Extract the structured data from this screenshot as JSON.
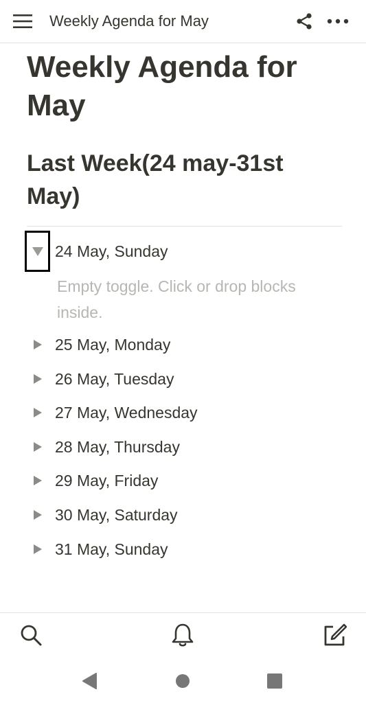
{
  "topbar": {
    "title": "Weekly Agenda for May",
    "menu_icon": "hamburger-menu-icon",
    "share_icon": "share-icon",
    "more_icon": "more-horizontal-icon"
  },
  "page": {
    "title": "Weekly Agenda for May",
    "heading": "Last Week(24 may-31st May)",
    "empty_toggle_hint": "Empty toggle. Click or drop blocks inside.",
    "toggles": [
      {
        "label": "24 May, Sunday",
        "expanded": true
      },
      {
        "label": "25 May, Monday",
        "expanded": false
      },
      {
        "label": "26 May, Tuesday",
        "expanded": false
      },
      {
        "label": "27 May, Wednesday",
        "expanded": false
      },
      {
        "label": "28 May, Thursday",
        "expanded": false
      },
      {
        "label": "29 May, Friday",
        "expanded": false
      },
      {
        "label": "30 May, Saturday",
        "expanded": false
      },
      {
        "label": "31 May, Sunday",
        "expanded": false
      }
    ]
  },
  "bottombar": {
    "search_icon": "search-icon",
    "notifications_icon": "bell-icon",
    "new_page_icon": "compose-icon"
  },
  "navbar": {
    "back_icon": "back-triangle-icon",
    "home_icon": "home-circle-icon",
    "recents_icon": "recents-square-icon"
  },
  "colors": {
    "text": "#37352f",
    "placeholder": "#b7b6b2",
    "toggle_arrow": "#9b9a97",
    "divider": "#e3e2df"
  }
}
